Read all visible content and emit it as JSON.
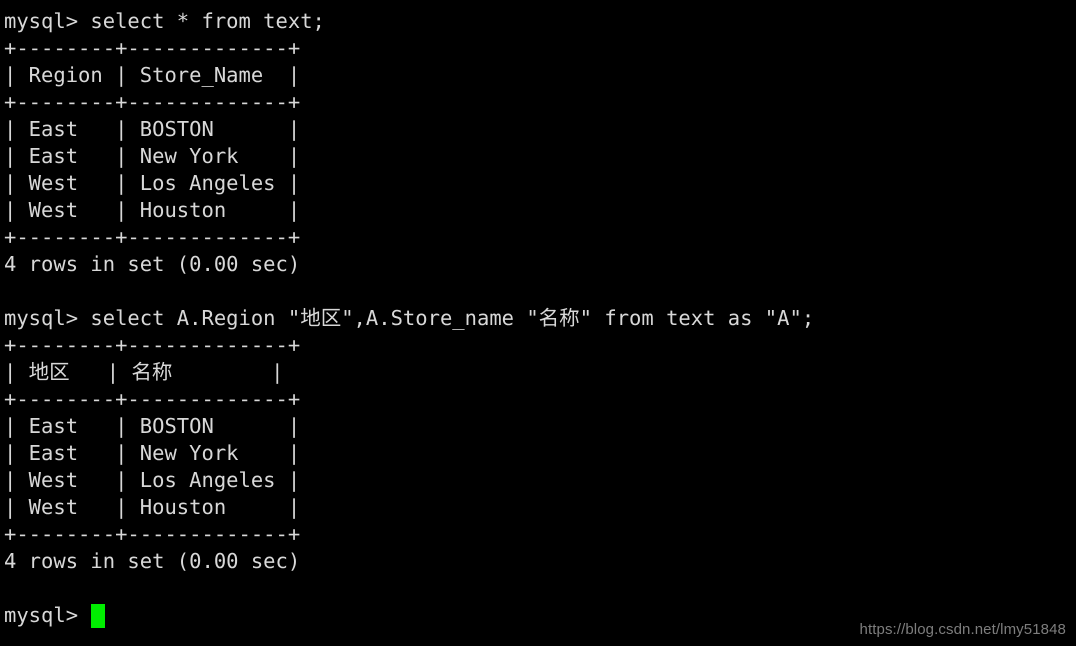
{
  "terminal": {
    "background_color": "#000000",
    "foreground_color": "#d8d8d8",
    "cursor_color": "#00ee00",
    "lines": [
      {
        "id": "l01",
        "name": "command-line-select-all",
        "text": "mysql> select * from text;"
      },
      {
        "id": "l02",
        "name": "table1-top-border",
        "text": "+--------+-------------+"
      },
      {
        "id": "l03",
        "name": "table1-header-row",
        "text": "| Region | Store_Name  |"
      },
      {
        "id": "l04",
        "name": "table1-header-separator",
        "text": "+--------+-------------+"
      },
      {
        "id": "l05",
        "name": "table1-row-1",
        "text": "| East   | BOSTON      |"
      },
      {
        "id": "l06",
        "name": "table1-row-2",
        "text": "| East   | New York    |"
      },
      {
        "id": "l07",
        "name": "table1-row-3",
        "text": "| West   | Los Angeles |"
      },
      {
        "id": "l08",
        "name": "table1-row-4",
        "text": "| West   | Houston     |"
      },
      {
        "id": "l09",
        "name": "table1-bottom-border",
        "text": "+--------+-------------+"
      },
      {
        "id": "l10",
        "name": "table1-result-status",
        "text": "4 rows in set (0.00 sec)"
      },
      {
        "id": "l11",
        "name": "blank-line-1",
        "text": " "
      },
      {
        "id": "l12",
        "name": "command-line-select-aliased",
        "text": "mysql> select A.Region \"地区\",A.Store_name \"名称\" from text as \"A\";"
      },
      {
        "id": "l13",
        "name": "table2-top-border",
        "text": "+--------+-------------+"
      },
      {
        "id": "l14",
        "name": "table2-header-row",
        "text": "| 地区   | 名称        |"
      },
      {
        "id": "l15",
        "name": "table2-header-separator",
        "text": "+--------+-------------+"
      },
      {
        "id": "l16",
        "name": "table2-row-1",
        "text": "| East   | BOSTON      |"
      },
      {
        "id": "l17",
        "name": "table2-row-2",
        "text": "| East   | New York    |"
      },
      {
        "id": "l18",
        "name": "table2-row-3",
        "text": "| West   | Los Angeles |"
      },
      {
        "id": "l19",
        "name": "table2-row-4",
        "text": "| West   | Houston     |"
      },
      {
        "id": "l20",
        "name": "table2-bottom-border",
        "text": "+--------+-------------+"
      },
      {
        "id": "l21",
        "name": "table2-result-status",
        "text": "4 rows in set (0.00 sec)"
      },
      {
        "id": "l22",
        "name": "blank-line-2",
        "text": " "
      }
    ],
    "final_prompt": "mysql> ",
    "queries": [
      {
        "prompt": "mysql> ",
        "sql": "select * from text;",
        "result": {
          "columns": [
            "Region",
            "Store_Name"
          ],
          "rows": [
            [
              "East",
              "BOSTON"
            ],
            [
              "East",
              "New York"
            ],
            [
              "West",
              "Los Angeles"
            ],
            [
              "West",
              "Houston"
            ]
          ],
          "status": "4 rows in set (0.00 sec)",
          "row_count": 4,
          "duration": "0.00 sec"
        }
      },
      {
        "prompt": "mysql> ",
        "sql": "select A.Region \"地区\",A.Store_name \"名称\" from text as \"A\";",
        "result": {
          "columns": [
            "地区",
            "名称"
          ],
          "rows": [
            [
              "East",
              "BOSTON"
            ],
            [
              "East",
              "New York"
            ],
            [
              "West",
              "Los Angeles"
            ],
            [
              "West",
              "Houston"
            ]
          ],
          "status": "4 rows in set (0.00 sec)",
          "row_count": 4,
          "duration": "0.00 sec"
        }
      }
    ]
  },
  "watermark": {
    "text": "https://blog.csdn.net/lmy51848"
  }
}
